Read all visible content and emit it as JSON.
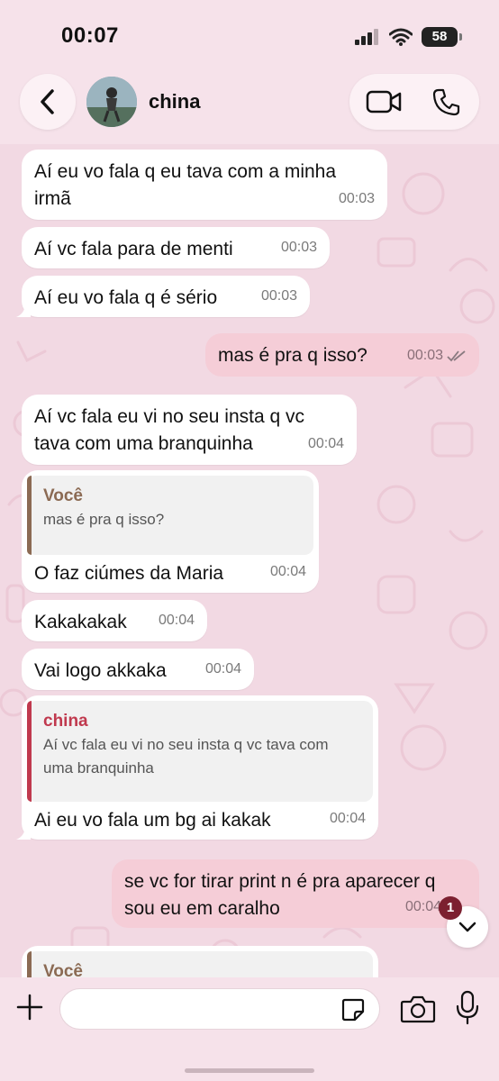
{
  "status_bar": {
    "time": "00:07",
    "battery": "58"
  },
  "header": {
    "contact_name": "china"
  },
  "messages": [
    {
      "dir": "in",
      "text": "Aí eu vo fala q eu tava com a minha irmã",
      "time": "00:03"
    },
    {
      "dir": "in",
      "text": "Aí vc fala para de menti",
      "time": "00:03"
    },
    {
      "dir": "in",
      "text": "Aí eu vo fala q é sério",
      "time": "00:03"
    },
    {
      "dir": "out",
      "text": "mas é pra q isso?",
      "time": "00:03",
      "read": true
    },
    {
      "dir": "in",
      "text": "Aí vc fala eu vi no seu insta q vc tava com uma branquinha",
      "time": "00:04"
    },
    {
      "dir": "in",
      "quote_author": "Você",
      "quote_text": "mas é pra q isso?",
      "text": "O faz ciúmes da Maria",
      "time": "00:04"
    },
    {
      "dir": "in",
      "text": "Kakakakak",
      "time": "00:04"
    },
    {
      "dir": "in",
      "text": "Vai logo akkaka",
      "time": "00:04"
    },
    {
      "dir": "in",
      "quote_author": "china",
      "quote_text": "Aí vc fala eu vi no seu insta q vc tava com uma branquinha",
      "text": "Ai eu vo fala um bg ai kakak",
      "time": "00:04"
    },
    {
      "dir": "out",
      "text": "se vc for tirar print n é pra aparecer q sou eu em caralho",
      "time": "00:04"
    },
    {
      "dir": "in",
      "quote_author": "Você",
      "partial": true
    }
  ],
  "unread_count": "1",
  "composer": {
    "value": "",
    "placeholder": ""
  },
  "colors": {
    "outgoing_bubble": "#f5cdd7",
    "incoming_bubble": "#ffffff",
    "quote_you": "#8b6a53",
    "quote_contact": "#c0394e",
    "badge": "#7c2030"
  }
}
